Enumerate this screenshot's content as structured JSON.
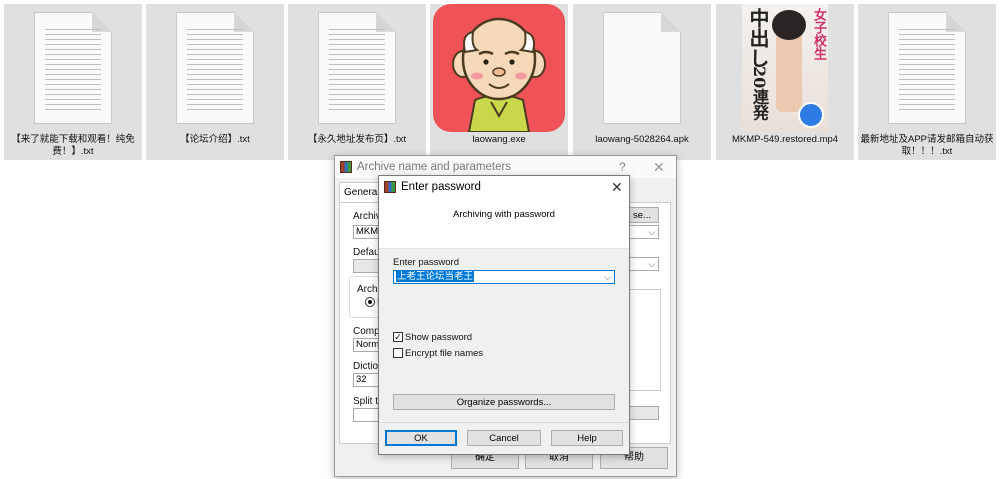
{
  "files": [
    {
      "name": "【来了就能下载和观看！纯免费！】.txt",
      "icon": "text-file-icon"
    },
    {
      "name": "【论坛介绍】.txt",
      "icon": "text-file-icon"
    },
    {
      "name": "【永久地址发布页】.txt",
      "icon": "text-file-icon"
    },
    {
      "name": "laowang.exe",
      "icon": "app-icon"
    },
    {
      "name": "laowang-5028264.apk",
      "icon": "blank-file-icon"
    },
    {
      "name": "MKMP-549.restored.mp4",
      "icon": "video-thumbnail"
    },
    {
      "name": "最新地址及APP请发邮箱自动获取！！！.txt",
      "icon": "text-file-icon"
    }
  ],
  "video_thumb_text": {
    "line1": "中出し",
    "line2": "20連発",
    "side": "女子校生"
  },
  "archive_dialog": {
    "title": "Archive name and parameters",
    "help_glyph": "?",
    "close_glyph": "✕",
    "tab_general": "General",
    "archive_label": "Archive",
    "archive_value": "MKMP-",
    "browse_suffix": "se...",
    "default_label": "Default",
    "archive_format_label": "Archiv",
    "format_radio_text": "F",
    "compression_label": "Compre",
    "compression_value": "Norma",
    "dictionary_label": "Diction",
    "dictionary_value": "32",
    "split_label": "Split to",
    "ok_label": "确定",
    "cancel_label": "取消",
    "help_label": "帮助"
  },
  "password_dialog": {
    "title": "Enter password",
    "close_glyph": "✕",
    "heading": "Archiving with password",
    "enter_password_label": "Enter password",
    "password_value": "上老王论坛当老王",
    "show_password_label": "Show password",
    "show_password_checked": true,
    "encrypt_names_label": "Encrypt file names",
    "encrypt_names_checked": false,
    "organize_label": "Organize passwords...",
    "ok_label": "OK",
    "cancel_label": "Cancel",
    "help_label": "Help"
  },
  "colors": {
    "selection": "#0078d7",
    "exe_bg": "#ef5257",
    "ok_border": "#0078d7"
  }
}
